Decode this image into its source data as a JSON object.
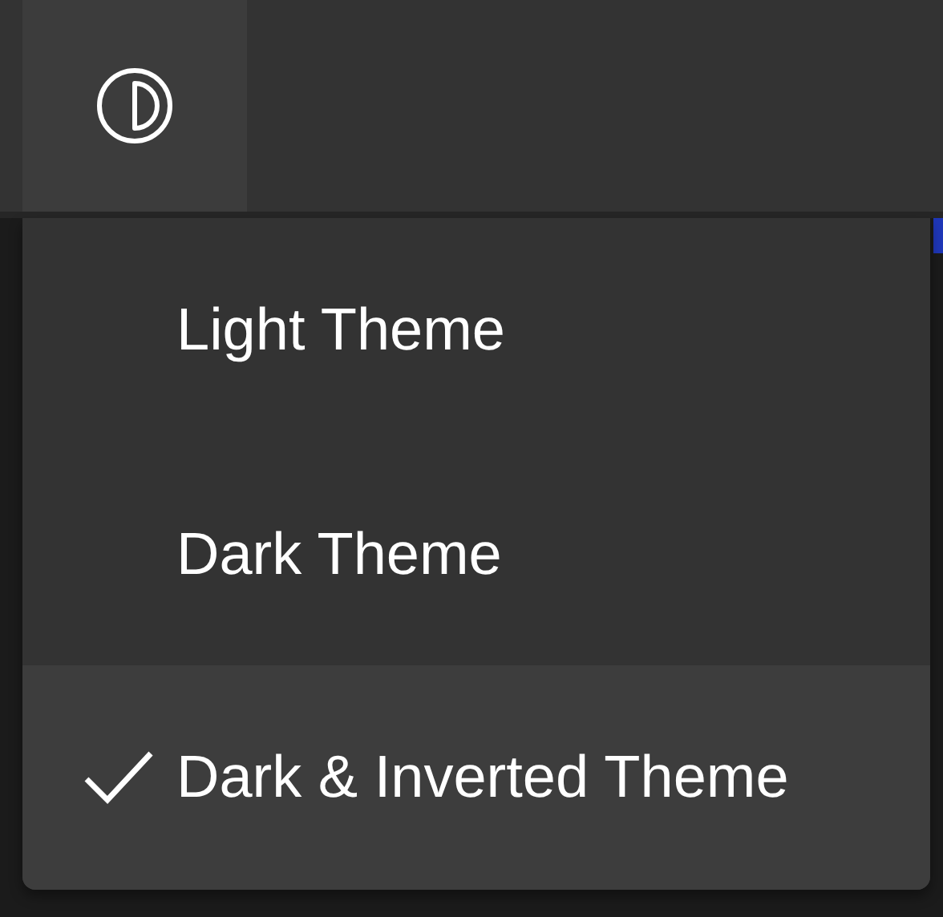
{
  "theme_menu": {
    "items": [
      {
        "label": "Light Theme",
        "selected": false
      },
      {
        "label": "Dark Theme",
        "selected": false
      },
      {
        "label": "Dark & Inverted Theme",
        "selected": true
      }
    ]
  }
}
